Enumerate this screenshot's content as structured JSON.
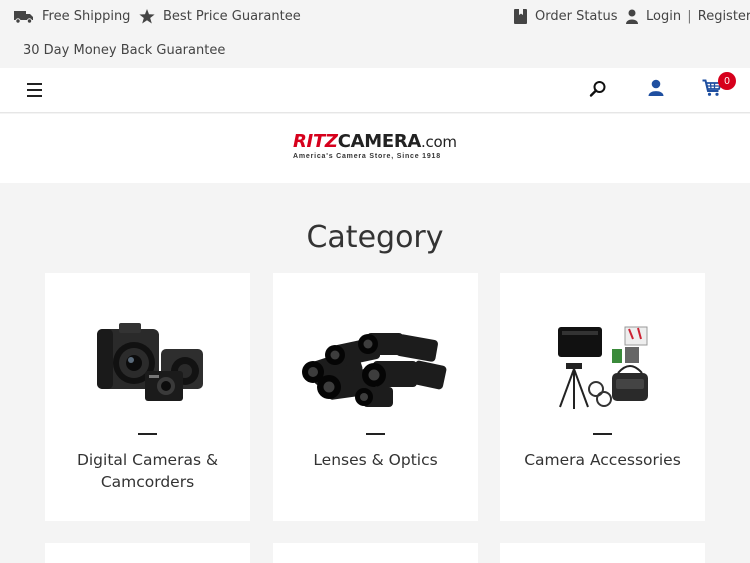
{
  "topbar": {
    "free_shipping": "Free Shipping",
    "best_price": "Best Price Guarantee",
    "money_back": "30 Day Money Back Guarantee",
    "order_status": "Order Status",
    "login": "Login",
    "separator": "|",
    "register": "Register"
  },
  "nav": {
    "cart_count": "0",
    "icons": [
      "menu-icon",
      "search-icon",
      "user-icon",
      "cart-icon"
    ]
  },
  "logo": {
    "brand_red": "RITZ",
    "brand_dark": "CAMERA",
    "brand_suffix": ".com",
    "tagline": "America's Camera Store, Since 1918"
  },
  "category": {
    "title": "Category",
    "items": [
      {
        "label": "Digital Cameras & Camcorders",
        "image": "cameras-image"
      },
      {
        "label": "Lenses & Optics",
        "image": "lenses-image"
      },
      {
        "label": "Camera Accessories",
        "image": "accessories-image"
      }
    ]
  },
  "colors": {
    "accent_blue": "#1f4fa0",
    "brand_red": "#d6001c",
    "background": "#f4f4f4",
    "card": "#ffffff"
  }
}
